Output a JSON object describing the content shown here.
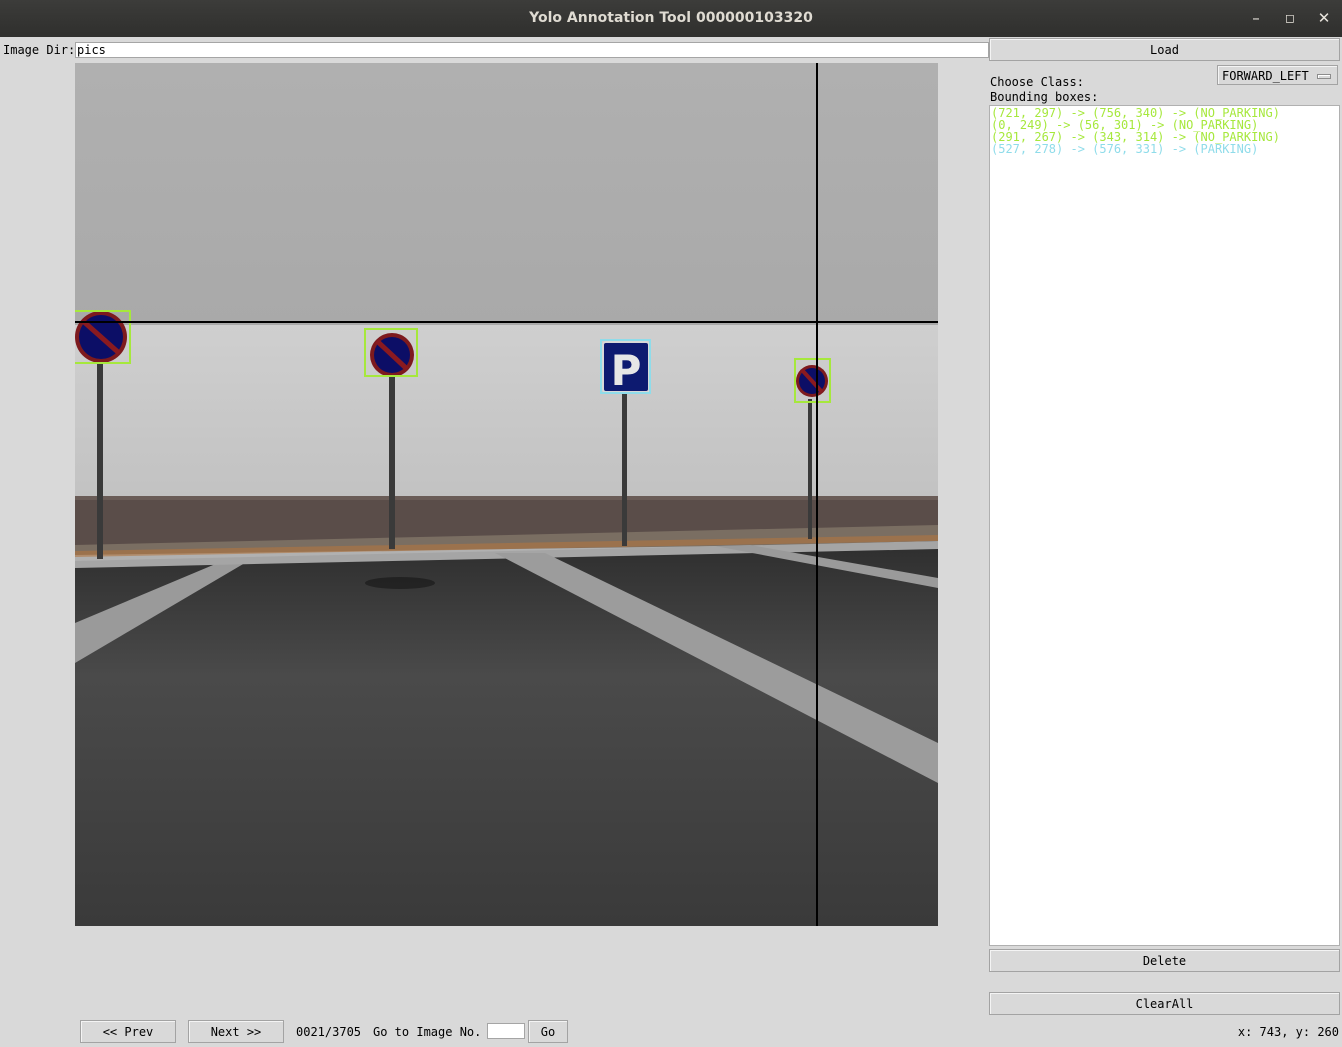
{
  "window": {
    "title": "Yolo Annotation Tool 000000103320",
    "minimize_icon": "minimize-icon",
    "maximize_icon": "maximize-icon",
    "close_icon": "close-icon"
  },
  "image_dir": {
    "label": "Image Dir:",
    "value": "pics"
  },
  "load_button": "Load",
  "class_chooser": {
    "label": "Choose Class:",
    "selected": "FORWARD_LEFT"
  },
  "bounding_boxes": {
    "label": "Bounding boxes:",
    "items": [
      {
        "text": "(721, 297) -> (756, 340) -> (NO_PARKING)",
        "color": "#a6e83c"
      },
      {
        "text": "(0, 249) -> (56, 301) -> (NO_PARKING)",
        "color": "#a6e83c"
      },
      {
        "text": "(291, 267) -> (343, 314) -> (NO_PARKING)",
        "color": "#a6e83c"
      },
      {
        "text": "(527, 278) -> (576, 331) -> (PARKING)",
        "color": "#8fdcea"
      }
    ]
  },
  "delete_button": "Delete",
  "clear_all_button": "ClearAll",
  "nav": {
    "prev": "<< Prev",
    "next": "Next >>",
    "progress": "0021/3705",
    "goto_label": "Go to Image No.",
    "goto_value": "",
    "go_button": "Go"
  },
  "cursor_readout": "x: 743, y: 260",
  "colors": {
    "no_parking_box": "#a6e83c",
    "parking_box": "#8fdcea",
    "crosshair": "#000000"
  }
}
